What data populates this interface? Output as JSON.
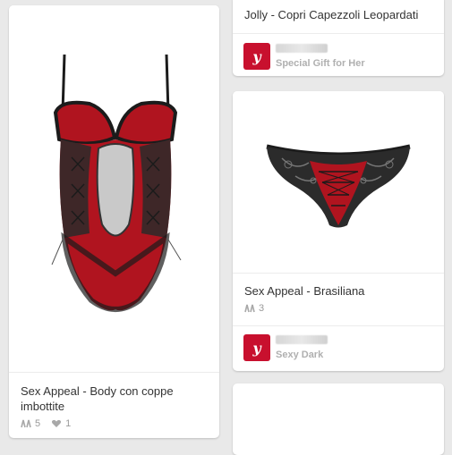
{
  "colors": {
    "accent": "#c8102e",
    "lingerie_red": "#b0141f",
    "lace_black": "#1b1b1b"
  },
  "pins": {
    "body": {
      "title": "Sex Appeal - Body con coppe imbottite",
      "repins": "5",
      "likes": "1",
      "repin_icon": "repin-icon",
      "like_icon": "heart-icon"
    },
    "jolly": {
      "title": "Jolly - Copri Capezzoli Leopardati",
      "board_name": "Special Gift for Her",
      "board_letter": "y"
    },
    "brasiliana": {
      "title": "Sex Appeal - Brasiliana",
      "repins": "3",
      "board_name": "Sexy Dark",
      "board_letter": "y"
    }
  }
}
